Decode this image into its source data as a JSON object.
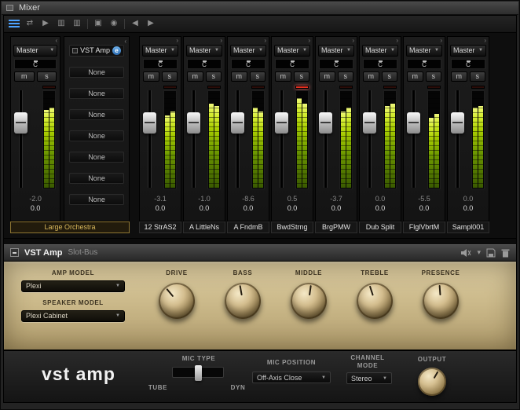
{
  "titlebar": {
    "title": "Mixer"
  },
  "icons": {
    "dropdown": "▼",
    "strip_expand": "›",
    "strip_collapse": "‹",
    "routing": "⇄",
    "monitor": "▶",
    "meter_view": "▥",
    "snapshot": "▣",
    "camera": "◉",
    "prev": "◀",
    "next": "▶",
    "chevron_down": "▾"
  },
  "mixer": {
    "mute_label": "m",
    "solo_label": "s",
    "channels": [
      {
        "output": "Master",
        "pan": "C",
        "peak": "-2.0",
        "gain": "0.0",
        "name": "Large Orchestra",
        "meter_l": 80,
        "meter_r": 82,
        "clip": false
      },
      {
        "output": "Master",
        "pan": "C",
        "peak": "-3.1",
        "gain": "0.0",
        "name": "12 StrAS2",
        "meter_l": 74,
        "meter_r": 78,
        "clip": false
      },
      {
        "output": "Master",
        "pan": "C",
        "peak": "-1.0",
        "gain": "0.0",
        "name": "A LittleNs",
        "meter_l": 86,
        "meter_r": 84,
        "clip": false
      },
      {
        "output": "Master",
        "pan": "C",
        "peak": "-8.6",
        "gain": "0.0",
        "name": "A FndmB",
        "meter_l": 82,
        "meter_r": 78,
        "clip": false
      },
      {
        "output": "Master",
        "pan": "C",
        "peak": "0.5",
        "gain": "0.0",
        "name": "BwdStrng",
        "meter_l": 92,
        "meter_r": 86,
        "clip": true
      },
      {
        "output": "Master",
        "pan": "C",
        "peak": "-3.7",
        "gain": "0.0",
        "name": "BrgPMW",
        "meter_l": 78,
        "meter_r": 82,
        "clip": false
      },
      {
        "output": "Master",
        "pan": "C",
        "peak": "0.0",
        "gain": "0.0",
        "name": "Dub Split",
        "meter_l": 84,
        "meter_r": 86,
        "clip": false
      },
      {
        "output": "Master",
        "pan": "C",
        "peak": "-5.5",
        "gain": "0.0",
        "name": "FlglVbrtM",
        "meter_l": 72,
        "meter_r": 76,
        "clip": false
      },
      {
        "output": "Master",
        "pan": "C",
        "peak": "0.0",
        "gain": "0.0",
        "name": "Sampl001",
        "meter_l": 82,
        "meter_r": 84,
        "clip": false
      }
    ],
    "inserts": {
      "active_slot": "VST Amp",
      "edit_button": "e",
      "empty_slots": [
        "None",
        "None",
        "None",
        "None",
        "None",
        "None",
        "None"
      ]
    }
  },
  "plugin": {
    "title": "VST Amp",
    "subtitle": "Slot-Bus",
    "amp_model_label": "AMP MODEL",
    "amp_model_value": "Plexi",
    "speaker_model_label": "SPEAKER MODEL",
    "speaker_model_value": "Plexi Cabinet",
    "knobs": [
      {
        "label": "DRIVE"
      },
      {
        "label": "BASS"
      },
      {
        "label": "MIDDLE"
      },
      {
        "label": "TREBLE"
      },
      {
        "label": "PRESENCE"
      }
    ],
    "logo": "vst amp",
    "mic_type_label": "MIC TYPE",
    "mic_type_left": "TUBE",
    "mic_type_right": "DYN",
    "mic_position_label": "MIC POSITION",
    "mic_position_value": "Off-Axis Close",
    "channel_mode_label_1": "CHANNEL",
    "channel_mode_label_2": "MODE",
    "channel_mode_value": "Stereo",
    "output_label": "OUTPUT"
  }
}
